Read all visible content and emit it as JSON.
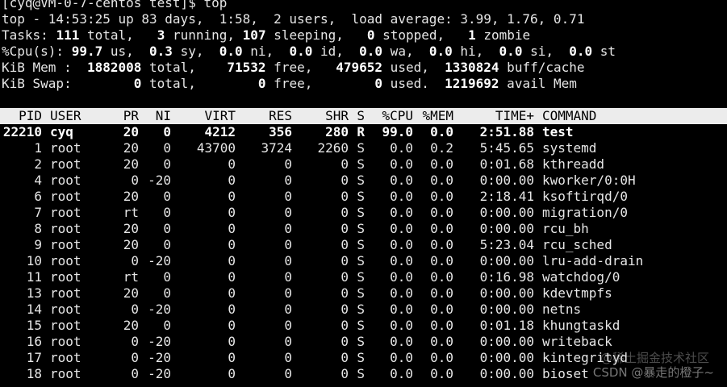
{
  "prompt_line": "[cyq@VM-0-7-centos test]$ top",
  "summary": {
    "uptime": "top - 14:53:25 up 83 days,  1:58,  2 users,  load average: 3.99, 1.76, 0.71",
    "tasks": {
      "label": "Tasks:",
      "total": "111",
      "total_lbl": " total,",
      "running": "3",
      "running_lbl": " running,",
      "sleeping": "107",
      "sleeping_lbl": " sleeping,",
      "stopped": "0",
      "stopped_lbl": " stopped,",
      "zombie": "1",
      "zombie_lbl": " zombie"
    },
    "cpu": {
      "label": "%Cpu(s):",
      "us": "99.7",
      "us_lbl": " us,",
      "sy": "0.3",
      "sy_lbl": " sy,",
      "ni": "0.0",
      "ni_lbl": " ni,",
      "id": "0.0",
      "id_lbl": " id,",
      "wa": "0.0",
      "wa_lbl": " wa,",
      "hi": "0.0",
      "hi_lbl": " hi,",
      "si": "0.0",
      "si_lbl": " si,",
      "st": "0.0",
      "st_lbl": " st"
    },
    "mem": {
      "label": "KiB Mem :",
      "total": "1882008",
      "total_lbl": " total,",
      "free": "71532",
      "free_lbl": " free,",
      "used": "479652",
      "used_lbl": " used,",
      "buff": "1330824",
      "buff_lbl": " buff/cache"
    },
    "swap": {
      "label": "KiB Swap:",
      "total": "0",
      "total_lbl": " total,",
      "free": "0",
      "free_lbl": " free,",
      "used": "0",
      "used_lbl": " used.",
      "avail": "1219692",
      "avail_lbl": " avail Mem"
    }
  },
  "table": {
    "headers": {
      "pid": "PID",
      "user": "USER",
      "pr": "PR",
      "ni": "NI",
      "virt": "VIRT",
      "res": "RES",
      "shr": "SHR",
      "s": "S",
      "cpu": "%CPU",
      "mem": "%MEM",
      "time": "TIME+",
      "command": "COMMAND"
    },
    "rows": [
      {
        "pid": "22210",
        "user": "cyq",
        "pr": "20",
        "ni": "0",
        "virt": "4212",
        "res": "356",
        "shr": "280",
        "s": "R",
        "cpu": "99.0",
        "mem": "0.0",
        "time": "2:51.88",
        "command": "test",
        "bold": true
      },
      {
        "pid": "1",
        "user": "root",
        "pr": "20",
        "ni": "0",
        "virt": "43700",
        "res": "3724",
        "shr": "2260",
        "s": "S",
        "cpu": "0.0",
        "mem": "0.2",
        "time": "5:45.65",
        "command": "systemd"
      },
      {
        "pid": "2",
        "user": "root",
        "pr": "20",
        "ni": "0",
        "virt": "0",
        "res": "0",
        "shr": "0",
        "s": "S",
        "cpu": "0.0",
        "mem": "0.0",
        "time": "0:01.68",
        "command": "kthreadd"
      },
      {
        "pid": "4",
        "user": "root",
        "pr": "0",
        "ni": "-20",
        "virt": "0",
        "res": "0",
        "shr": "0",
        "s": "S",
        "cpu": "0.0",
        "mem": "0.0",
        "time": "0:00.00",
        "command": "kworker/0:0H"
      },
      {
        "pid": "6",
        "user": "root",
        "pr": "20",
        "ni": "0",
        "virt": "0",
        "res": "0",
        "shr": "0",
        "s": "S",
        "cpu": "0.0",
        "mem": "0.0",
        "time": "2:18.41",
        "command": "ksoftirqd/0"
      },
      {
        "pid": "7",
        "user": "root",
        "pr": "rt",
        "ni": "0",
        "virt": "0",
        "res": "0",
        "shr": "0",
        "s": "S",
        "cpu": "0.0",
        "mem": "0.0",
        "time": "0:00.00",
        "command": "migration/0"
      },
      {
        "pid": "8",
        "user": "root",
        "pr": "20",
        "ni": "0",
        "virt": "0",
        "res": "0",
        "shr": "0",
        "s": "S",
        "cpu": "0.0",
        "mem": "0.0",
        "time": "0:00.00",
        "command": "rcu_bh"
      },
      {
        "pid": "9",
        "user": "root",
        "pr": "20",
        "ni": "0",
        "virt": "0",
        "res": "0",
        "shr": "0",
        "s": "S",
        "cpu": "0.0",
        "mem": "0.0",
        "time": "5:23.04",
        "command": "rcu_sched"
      },
      {
        "pid": "10",
        "user": "root",
        "pr": "0",
        "ni": "-20",
        "virt": "0",
        "res": "0",
        "shr": "0",
        "s": "S",
        "cpu": "0.0",
        "mem": "0.0",
        "time": "0:00.00",
        "command": "lru-add-drain"
      },
      {
        "pid": "11",
        "user": "root",
        "pr": "rt",
        "ni": "0",
        "virt": "0",
        "res": "0",
        "shr": "0",
        "s": "S",
        "cpu": "0.0",
        "mem": "0.0",
        "time": "0:16.98",
        "command": "watchdog/0"
      },
      {
        "pid": "13",
        "user": "root",
        "pr": "20",
        "ni": "0",
        "virt": "0",
        "res": "0",
        "shr": "0",
        "s": "S",
        "cpu": "0.0",
        "mem": "0.0",
        "time": "0:00.00",
        "command": "kdevtmpfs"
      },
      {
        "pid": "14",
        "user": "root",
        "pr": "0",
        "ni": "-20",
        "virt": "0",
        "res": "0",
        "shr": "0",
        "s": "S",
        "cpu": "0.0",
        "mem": "0.0",
        "time": "0:00.00",
        "command": "netns"
      },
      {
        "pid": "15",
        "user": "root",
        "pr": "20",
        "ni": "0",
        "virt": "0",
        "res": "0",
        "shr": "0",
        "s": "S",
        "cpu": "0.0",
        "mem": "0.0",
        "time": "0:01.18",
        "command": "khungtaskd"
      },
      {
        "pid": "16",
        "user": "root",
        "pr": "0",
        "ni": "-20",
        "virt": "0",
        "res": "0",
        "shr": "0",
        "s": "S",
        "cpu": "0.0",
        "mem": "0.0",
        "time": "0:00.00",
        "command": "writeback"
      },
      {
        "pid": "17",
        "user": "root",
        "pr": "0",
        "ni": "-20",
        "virt": "0",
        "res": "0",
        "shr": "0",
        "s": "S",
        "cpu": "0.0",
        "mem": "0.0",
        "time": "0:00.00",
        "command": "kintegrityd"
      },
      {
        "pid": "18",
        "user": "root",
        "pr": "0",
        "ni": "-20",
        "virt": "0",
        "res": "0",
        "shr": "0",
        "s": "S",
        "cpu": "0.0",
        "mem": "0.0",
        "time": "0:00.00",
        "command": "bioset"
      }
    ]
  },
  "watermark": {
    "line1": "@稀土掘金技术社区",
    "line2": "CSDN @暴走的橙子~"
  }
}
